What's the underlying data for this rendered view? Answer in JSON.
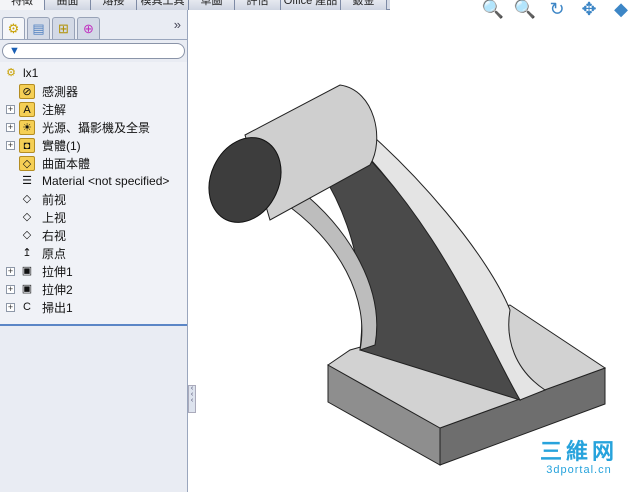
{
  "tabs": [
    "特徵",
    "曲面",
    "熔接",
    "模具工具",
    "草圖",
    "評估",
    "Office 產品",
    "鈑金"
  ],
  "active_tab": "特徵",
  "panel_tabs": [
    {
      "icon": "feature-manager-icon"
    },
    {
      "icon": "property-manager-icon"
    },
    {
      "icon": "configuration-manager-icon"
    },
    {
      "icon": "dim-xpert-icon"
    }
  ],
  "more_label": "»",
  "filter_icon": "filter-icon",
  "tree": {
    "root": "lx1",
    "items": [
      {
        "label": "感測器",
        "icon": "sensor-folder-icon",
        "expandable": false,
        "glyph": "⊘"
      },
      {
        "label": "注解",
        "icon": "annotations-folder-icon",
        "expandable": true,
        "glyph": "A"
      },
      {
        "label": "光源、攝影機及全景",
        "icon": "lights-folder-icon",
        "expandable": true,
        "glyph": "☀"
      },
      {
        "label": "實體(1)",
        "icon": "solid-bodies-folder-icon",
        "expandable": true,
        "glyph": "◘"
      },
      {
        "label": "曲面本體",
        "icon": "surface-bodies-folder-icon",
        "expandable": false,
        "glyph": "◇"
      },
      {
        "label": "Material <not specified>",
        "icon": "material-icon",
        "expandable": false,
        "glyph": "☰"
      },
      {
        "label": "前视",
        "icon": "plane-icon",
        "expandable": false,
        "glyph": "◇"
      },
      {
        "label": "上视",
        "icon": "plane-icon",
        "expandable": false,
        "glyph": "◇"
      },
      {
        "label": "右视",
        "icon": "plane-icon",
        "expandable": false,
        "glyph": "◇"
      },
      {
        "label": "原点",
        "icon": "origin-icon",
        "expandable": false,
        "glyph": "↥"
      },
      {
        "label": "拉伸1",
        "icon": "extrude-icon",
        "expandable": true,
        "glyph": "▣"
      },
      {
        "label": "拉伸2",
        "icon": "extrude-icon",
        "expandable": true,
        "glyph": "▣"
      },
      {
        "label": "掃出1",
        "icon": "sweep-icon",
        "expandable": true,
        "glyph": "C"
      }
    ]
  },
  "view_tools": [
    {
      "icon": "zoom-to-fit-icon",
      "glyph": "🔍"
    },
    {
      "icon": "zoom-to-area-icon",
      "glyph": "🔍"
    },
    {
      "icon": "rotate-icon",
      "glyph": "↻"
    },
    {
      "icon": "pan-icon",
      "glyph": "✥"
    },
    {
      "icon": "view-orientation-icon",
      "glyph": "◆"
    }
  ],
  "watermark": {
    "line1": "三維网",
    "line2": "3dportal.cn"
  }
}
